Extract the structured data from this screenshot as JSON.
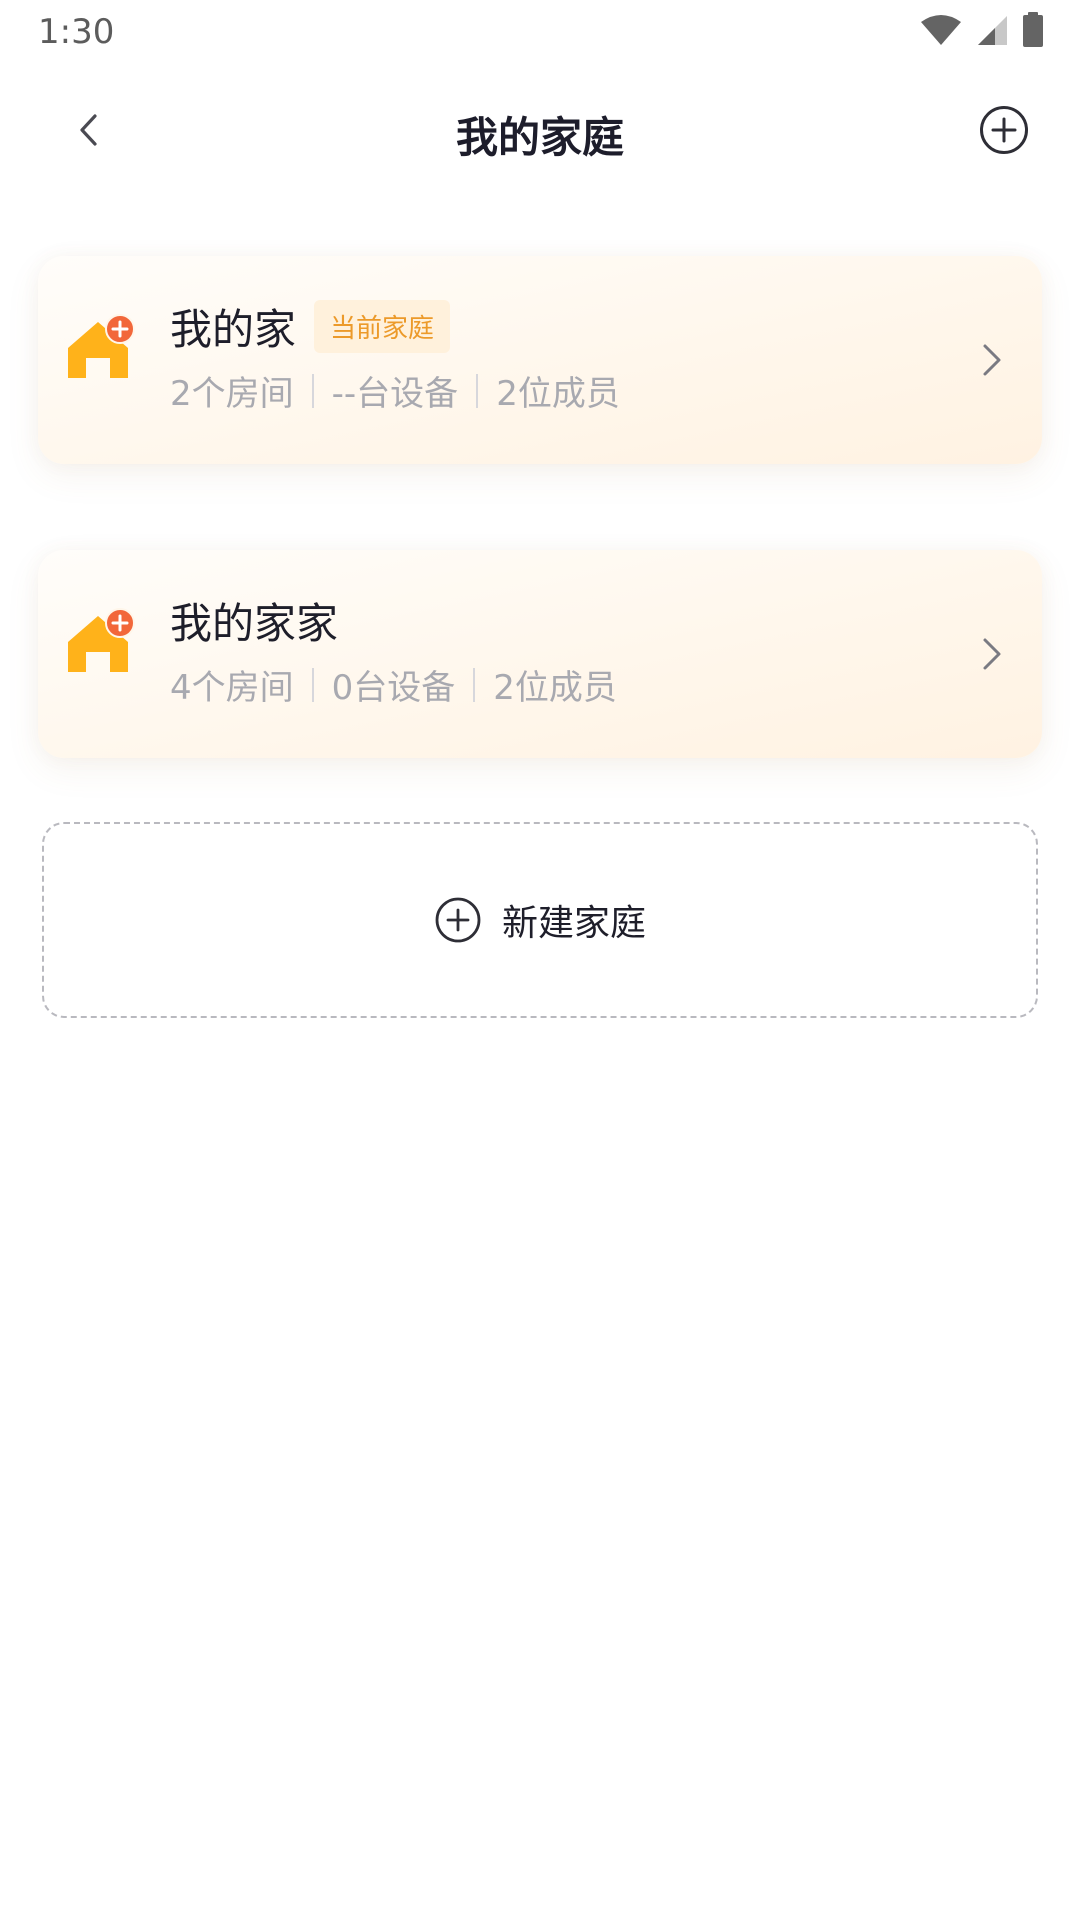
{
  "status_bar": {
    "time": "1:30"
  },
  "header": {
    "title": "我的家庭",
    "back_icon": "chevron-left-icon",
    "add_icon": "plus-circle-icon"
  },
  "families": [
    {
      "name": "我的家",
      "badge": "当前家庭",
      "rooms": "2个房间",
      "devices": "--台设备",
      "members": "2位成员"
    },
    {
      "name": "我的家家",
      "rooms": "4个房间",
      "devices": "0台设备",
      "members": "2位成员"
    }
  ],
  "new_family": {
    "label": "新建家庭",
    "icon": "plus-circle-icon"
  },
  "colors": {
    "accent": "#FFB21A",
    "badge_text": "#EC9A2A",
    "badge_bg": "#FFF1DC",
    "plus_dot": "#F2673A"
  }
}
